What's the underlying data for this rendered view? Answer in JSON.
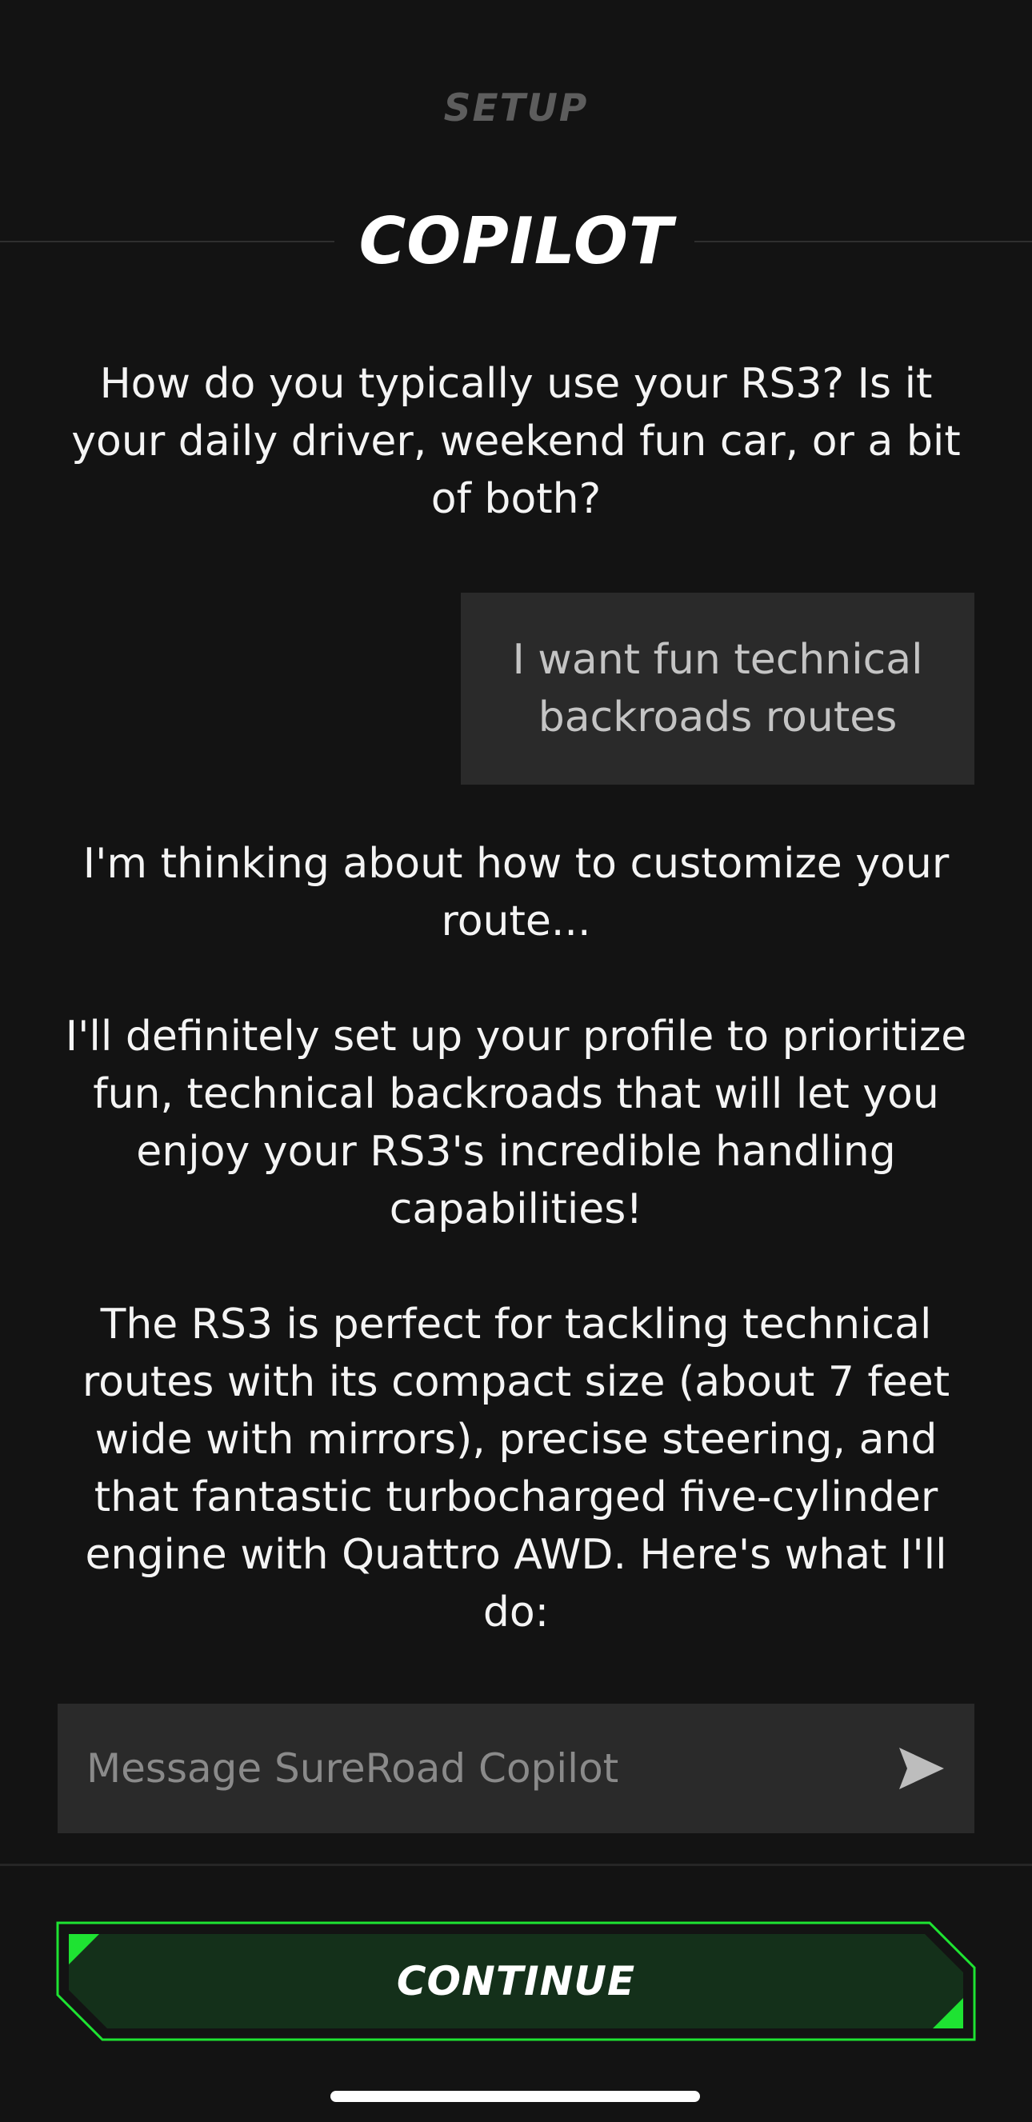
{
  "header": {
    "section_label": "SETUP",
    "title": "COPILOT"
  },
  "conversation": {
    "messages": [
      {
        "role": "assistant",
        "paragraphs": [
          "How do you typically use your RS3? Is it your daily driver, weekend fun car, or a bit of both?"
        ]
      },
      {
        "role": "user",
        "text": "I want fun technical backroads routes"
      },
      {
        "role": "assistant",
        "paragraphs": [
          "I'm thinking about how to customize your route...",
          "I'll definitely set up your profile to prioritize fun, technical backroads that will let you enjoy your RS3's incredible handling capabilities!",
          "The RS3 is perfect for tackling technical routes with its compact size (about 7 feet wide with mirrors), precise steering, and that fantastic turbocharged five-cylinder engine with Quattro AWD. Here's what I'll do:"
        ]
      }
    ]
  },
  "composer": {
    "placeholder": "Message SureRoad Copilot",
    "value": "",
    "send_icon": "send-icon"
  },
  "footer": {
    "continue_label": "CONTINUE"
  },
  "colors": {
    "background": "#131313",
    "bubble": "#2a2a2a",
    "accent_green": "#1ee332",
    "button_fill": "#14301a"
  }
}
